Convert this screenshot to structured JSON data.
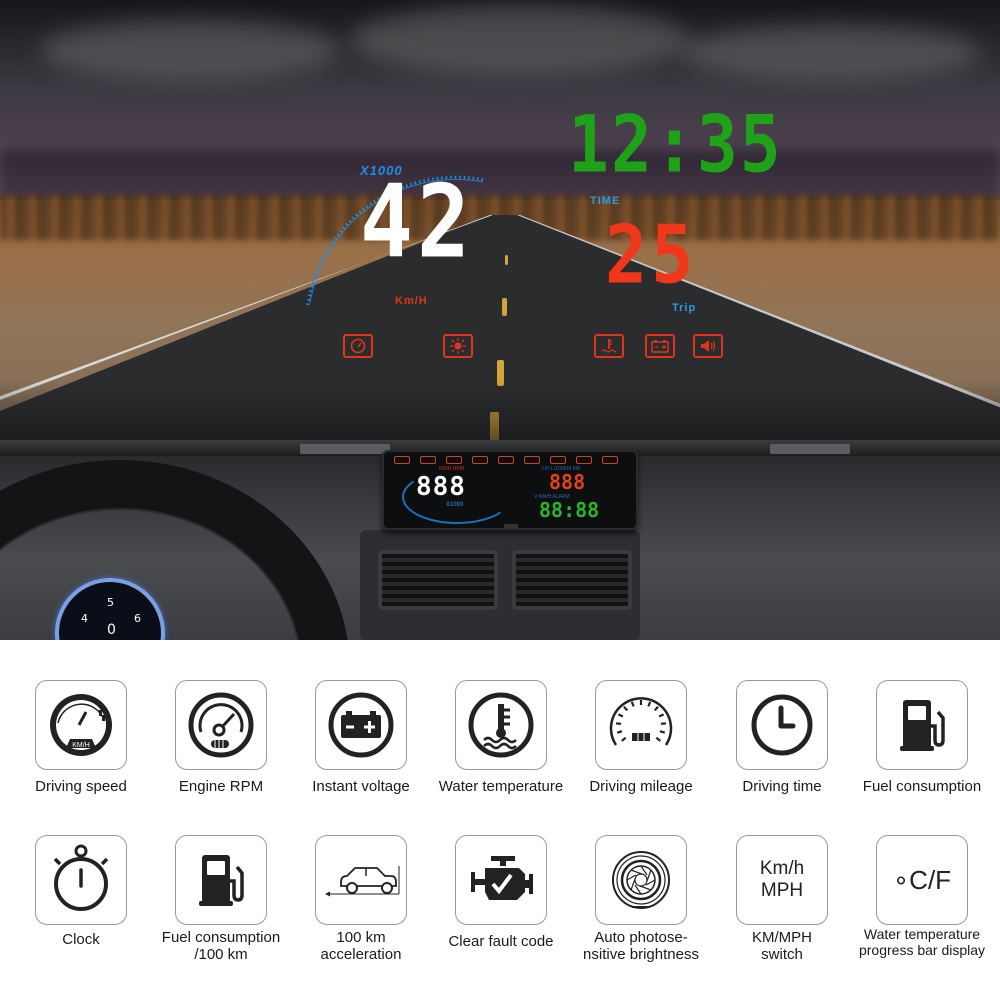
{
  "hud": {
    "speed": "42",
    "speed_unit": "Km/H",
    "rpm_multiplier": "X1000",
    "time": "12:35",
    "time_label": "TIME",
    "trip": "25",
    "trip_label": "Trip",
    "warning_icons": [
      {
        "name": "speedometer-icon",
        "glyph": "◷"
      },
      {
        "name": "brightness-icon",
        "glyph": "☀"
      },
      {
        "name": "water-temp-icon",
        "glyph": "♨"
      },
      {
        "name": "battery-icon",
        "glyph": "▭"
      },
      {
        "name": "speaker-icon",
        "glyph": "🔊"
      }
    ]
  },
  "device": {
    "speed_display": "888",
    "rpm_multiplier": "X1000",
    "top_label_left": "KM/H  RPM",
    "top_label_right": "L/H  L/100KM  KM",
    "red_display": "888",
    "mid_label": "V  KM/H  ALARM",
    "green_display": "88:88"
  },
  "cluster": {
    "numbers": [
      "4",
      "5",
      "6",
      "0"
    ]
  },
  "colors": {
    "hud_speed": "#ffffff",
    "hud_time": "#1fa21a",
    "hud_trip": "#f0371a",
    "hud_label_blue": "#2a9ce6",
    "hud_warning_red": "#e0351a"
  },
  "features": [
    {
      "icon": "speedometer-icon",
      "label": "Driving speed",
      "icon_text": "KM/H"
    },
    {
      "icon": "rpm-gauge-icon",
      "label": "Engine RPM"
    },
    {
      "icon": "battery-icon",
      "label": "Instant voltage"
    },
    {
      "icon": "water-temperature-icon",
      "label": "Water temperature"
    },
    {
      "icon": "odometer-icon",
      "label": "Driving mileage"
    },
    {
      "icon": "clock-icon",
      "label": "Driving time"
    },
    {
      "icon": "fuel-pump-icon",
      "label": "Fuel consumption"
    },
    {
      "icon": "stopwatch-icon",
      "label": "Clock"
    },
    {
      "icon": "fuel-pump-icon",
      "label": "Fuel consumption\n/100 km"
    },
    {
      "icon": "car-acceleration-icon",
      "label": "100 km\nacceleration"
    },
    {
      "icon": "engine-check-icon",
      "label": "Clear fault code"
    },
    {
      "icon": "aperture-icon",
      "label": "Auto photose-\nnsitive brightness"
    },
    {
      "icon": "unit-switch-icon",
      "label": "KM/MPH\nswitch",
      "icon_text": "Km/h\nMPH"
    },
    {
      "icon": "temp-unit-icon",
      "label": "Water temperature\nprogress bar display",
      "icon_text": "∘C/F"
    }
  ]
}
